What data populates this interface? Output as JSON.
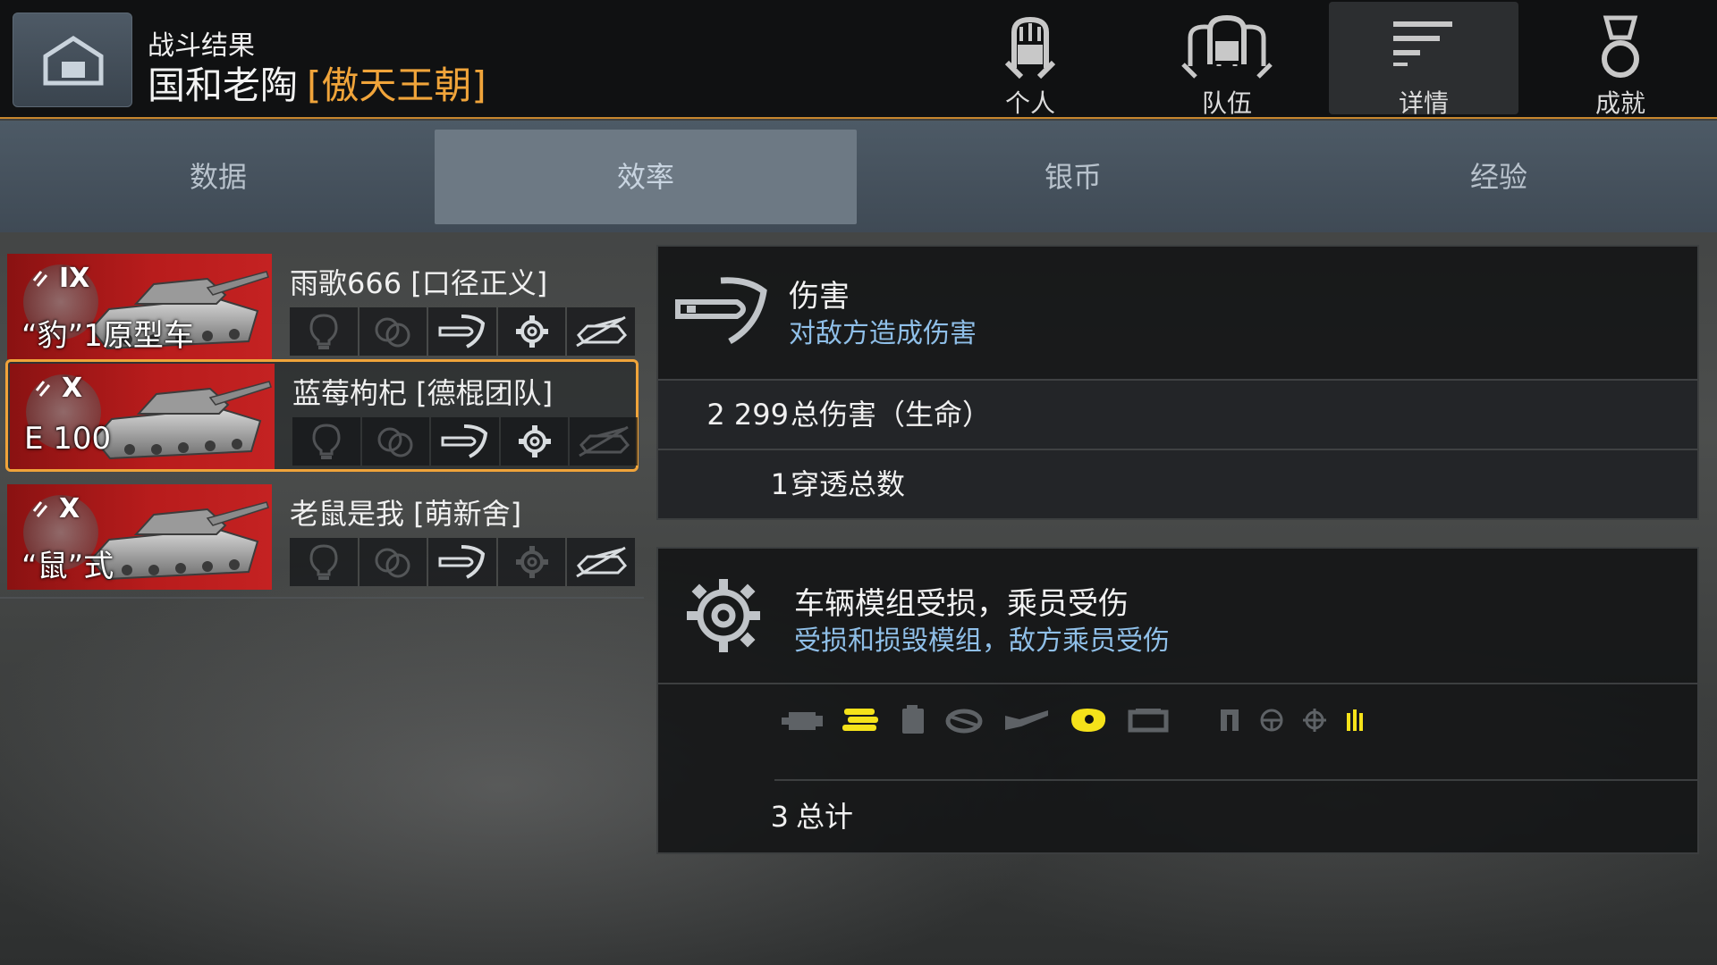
{
  "header": {
    "subtitle": "战斗结果",
    "player_name": "国和老陶",
    "clan_tag": "[傲天王朝]"
  },
  "top_nav": [
    {
      "label": "个人",
      "icon": "personal-helmet-icon",
      "active": false
    },
    {
      "label": "队伍",
      "icon": "team-helmets-icon",
      "active": false
    },
    {
      "label": "详情",
      "icon": "details-lines-icon",
      "active": true
    },
    {
      "label": "成就",
      "icon": "medal-icon",
      "active": false
    }
  ],
  "tabs": [
    {
      "label": "数据",
      "active": false
    },
    {
      "label": "效率",
      "active": true
    },
    {
      "label": "银币",
      "active": false
    },
    {
      "label": "经验",
      "active": false
    }
  ],
  "players": [
    {
      "name": "雨歌666 [口径正义]",
      "tank": "“豹”1原型车",
      "tier": "IX",
      "selected": false,
      "badges": [
        "spotting-bulb-icon",
        "assist-track-icon",
        "damage-shell-icon",
        "module-gear-icon",
        "kill-tank-icon"
      ],
      "badge_active": [
        false,
        false,
        true,
        true,
        true
      ]
    },
    {
      "name": "蓝莓枸杞 [德棍团队]",
      "tank": "E 100",
      "tier": "X",
      "selected": true,
      "badges": [
        "spotting-bulb-icon",
        "assist-track-icon",
        "damage-shell-icon",
        "module-gear-icon",
        "kill-tank-icon"
      ],
      "badge_active": [
        false,
        false,
        true,
        true,
        false
      ]
    },
    {
      "name": "老鼠是我 [萌新舍]",
      "tank": "“鼠”式",
      "tier": "X",
      "selected": false,
      "badges": [
        "spotting-bulb-icon",
        "assist-track-icon",
        "damage-shell-icon",
        "module-gear-icon",
        "kill-tank-icon"
      ],
      "badge_active": [
        false,
        false,
        true,
        false,
        true
      ]
    }
  ],
  "damage_panel": {
    "title": "伤害",
    "subtitle": "对敌方造成伤害",
    "rows": [
      {
        "value": "2 299",
        "label": "总伤害（生命）"
      },
      {
        "value": "1",
        "label": "穿透总数"
      }
    ]
  },
  "module_panel": {
    "title": "车辆模组受损，乘员受伤",
    "subtitle": "受损和损毁模组，敌方乘员受伤",
    "module_icons": [
      {
        "icon": "engine-icon",
        "highlighted": false
      },
      {
        "icon": "tracks-icon",
        "highlighted": true
      },
      {
        "icon": "fuel-tank-icon",
        "highlighted": false
      },
      {
        "icon": "turret-ring-icon",
        "highlighted": false
      },
      {
        "icon": "gun-icon",
        "highlighted": false
      },
      {
        "icon": "radio-icon",
        "highlighted": true
      },
      {
        "icon": "optics-icon",
        "highlighted": false
      },
      {
        "icon": "commander-icon",
        "highlighted": false
      },
      {
        "icon": "driver-icon",
        "highlighted": false
      },
      {
        "icon": "gunner-icon",
        "highlighted": false
      },
      {
        "icon": "loader-icon",
        "highlighted": true
      }
    ],
    "total": {
      "value": "3",
      "label": "总计"
    }
  },
  "colors": {
    "accent": "#f0a43a",
    "sub_text": "#8fbfe8",
    "highlight_icon": "#f5e21a",
    "tank_card_red": "#b81c1c"
  }
}
